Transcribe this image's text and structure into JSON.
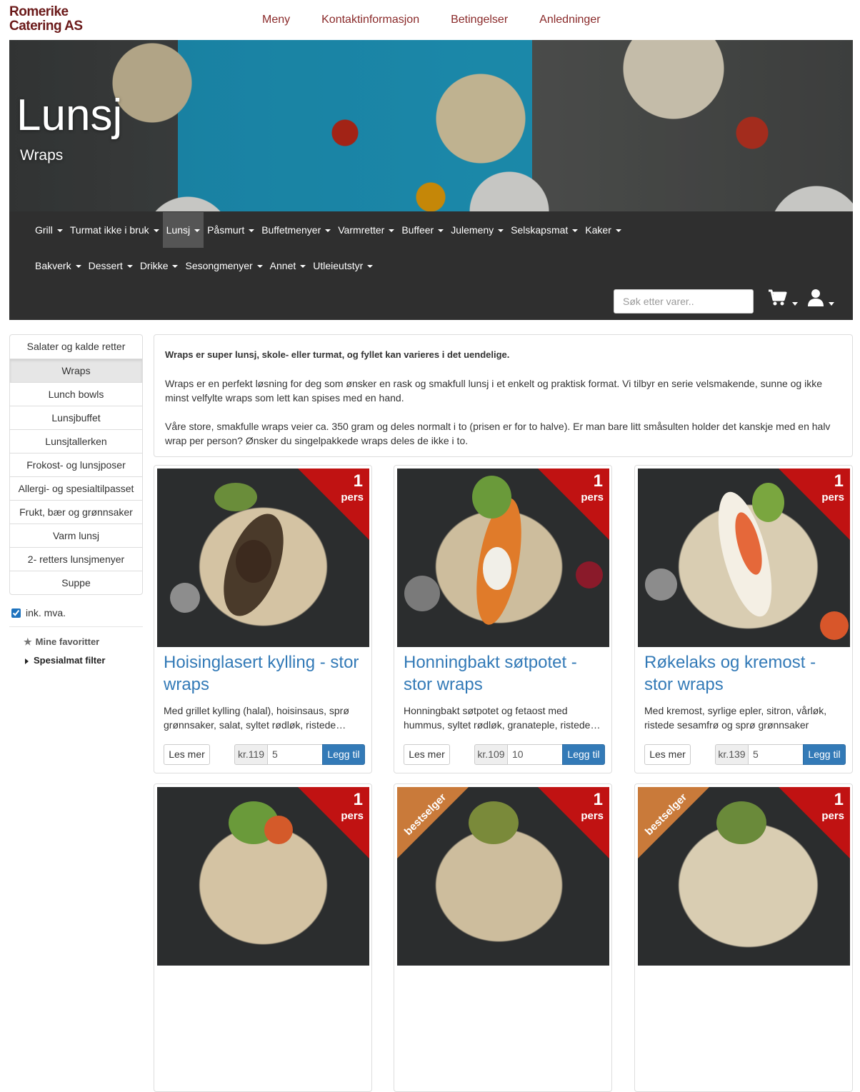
{
  "brand": {
    "line1": "Romerike",
    "line2": "Catering AS"
  },
  "topnav": [
    "Meny",
    "Kontaktinformasjon",
    "Betingelser",
    "Anledninger"
  ],
  "hero": {
    "title": "Lunsj",
    "subtitle": "Wraps"
  },
  "categories_row1": [
    "Grill",
    "Turmat ikke i bruk",
    "Lunsj",
    "Påsmurt",
    "Buffetmenyer",
    "Varmretter",
    "Buffeer",
    "Julemeny",
    "Selskapsmat",
    "Kaker"
  ],
  "categories_row2": [
    "Bakverk",
    "Dessert",
    "Drikke",
    "Sesongmenyer",
    "Annet",
    "Utleieutstyr"
  ],
  "active_category": "Lunsj",
  "search": {
    "placeholder": "Søk etter varer.."
  },
  "icons": {
    "cart": "cart-icon",
    "user": "user-icon",
    "star": "star-icon",
    "caret": "caret-icon"
  },
  "sidebar": {
    "items": [
      "Salater og kalde retter",
      "Wraps",
      "Lunch bowls",
      "Lunsjbuffet",
      "Lunsjtallerken",
      "Frokost- og lunsjposer",
      "Allergi- og spesialtilpasset",
      "Frukt, bær og grønnsaker",
      "Varm lunsj",
      "2- retters lunsjmenyer",
      "Suppe"
    ],
    "active": "Wraps",
    "vat_label": "ink. mva.",
    "vat_checked": true,
    "favorites": "Mine favoritter",
    "filter": "Spesialmat filter"
  },
  "intro": {
    "p1": "Wraps er super lunsj, skole- eller turmat, og fyllet kan varieres i det uendelige.",
    "p2": "Wraps er en perfekt løsning for deg som ønsker en rask og smakfull lunsj i et enkelt og praktisk format. Vi tilbyr en serie velsmakende, sunne og ikke minst velfylte wraps som lett kan spises med en hand.",
    "p3": "Våre store, smakfulle wraps veier ca. 350 gram og deles normalt i to (prisen er for to halve). Er man bare litt småsulten holder det kanskje med en halv wrap per person? Ønsker du singelpakkede wraps deles de ikke i to."
  },
  "badge": {
    "num": "1",
    "unit": "pers",
    "bestseller": "bestselger"
  },
  "buttons": {
    "more": "Les mer",
    "add": "Legg til"
  },
  "products": [
    {
      "title": "Hoisinglasert kylling - stor wraps",
      "desc": "Med grillet kylling (halal), hoisinsaus, sprø grønnsaker, salat, syltet rødløk, ristede sesamfrø",
      "price": "kr.119",
      "qty": "5"
    },
    {
      "title": "Honningbakt søtpotet - stor wraps",
      "desc": "Honningbakt søtpotet og fetaost med hummus, syltet rødløk, granateple, ristede gresskarkjerner",
      "price": "kr.109",
      "qty": "10"
    },
    {
      "title": "Røkelaks og kremost - stor wraps",
      "desc": "Med kremost, syrlige epler, sitron, vårløk, ristede sesamfrø og sprø grønnsaker",
      "price": "kr.139",
      "qty": "5"
    }
  ]
}
